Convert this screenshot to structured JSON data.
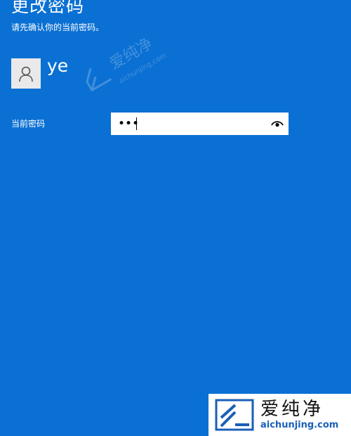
{
  "page": {
    "title": "更改密码",
    "subtitle": "请先确认你的当前密码。"
  },
  "account": {
    "username": "ye",
    "avatar_icon": "user-silhouette-icon"
  },
  "password_field": {
    "label": "当前密码",
    "masked_value": "•••",
    "reveal_icon": "eye-icon"
  },
  "watermark": {
    "name": "爱纯净",
    "url": "aichunjing.com"
  },
  "colors": {
    "background": "#0b70d3",
    "text": "#ffffff",
    "input_background": "#ffffff",
    "avatar_background": "#e9e9e9"
  }
}
